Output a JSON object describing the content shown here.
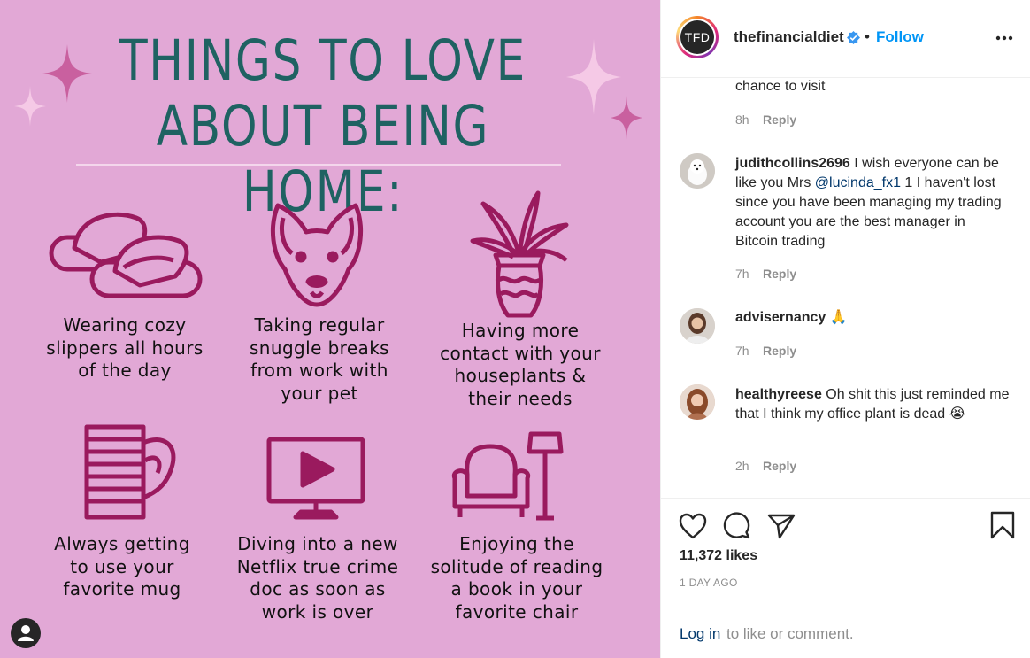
{
  "image": {
    "headline_line1": "THINGS TO LOVE",
    "headline_line2": "ABOUT BEING HOME:",
    "items": [
      {
        "icon": "slippers-icon",
        "caption": "Wearing cozy\nslippers all hours\nof the day"
      },
      {
        "icon": "dog-icon",
        "caption": "Taking regular\nsnuggle breaks\nfrom work with\nyour pet"
      },
      {
        "icon": "houseplant-icon",
        "caption": "Having more\ncontact with your\nhouseplants &\ntheir needs"
      },
      {
        "icon": "mug-icon",
        "caption": "Always getting\nto use your\nfavorite mug"
      },
      {
        "icon": "tv-play-icon",
        "caption": "Diving into a new\nNetflix true crime\ndoc as soon as\nwork is over"
      },
      {
        "icon": "armchair-lamp-icon",
        "caption": "Enjoying the\nsolitude of reading\na book in your\nfavorite chair"
      }
    ],
    "colors": {
      "background": "#e2a8d6",
      "headline": "#1f6262",
      "illustration": "#9a1a5e"
    }
  },
  "header": {
    "logo_text": "TFD",
    "username": "thefinancialdiet",
    "separator": "•",
    "follow_label": "Follow",
    "more_icon": "more-horizontal-icon",
    "verified_icon": "verified-badge-icon"
  },
  "comments": [
    {
      "user": "",
      "text": "chance to visit",
      "time": "8h",
      "reply": "Reply"
    },
    {
      "user": "judithcollins2696",
      "text_before": " I wish everyone can be like you Mrs ",
      "mention": "@lucinda_fx1",
      "text_after": " 1 I haven't lost since you have been managing my trading account you are the best manager in Bitcoin trading",
      "time": "7h",
      "reply": "Reply"
    },
    {
      "user": "advisernancy",
      "text": " 🙏",
      "time": "7h",
      "reply": "Reply"
    },
    {
      "user": "healthyreese",
      "text": " Oh shit this just reminded me that I think my office plant is dead 😭",
      "time": "2h",
      "reply": "Reply"
    }
  ],
  "actions": {
    "icons": [
      "heart-icon",
      "comment-icon",
      "share-icon",
      "bookmark-icon"
    ],
    "likes": "11,372 likes",
    "time": "1 DAY AGO"
  },
  "footer": {
    "login_label": "Log in",
    "login_rest": " to like or comment."
  }
}
